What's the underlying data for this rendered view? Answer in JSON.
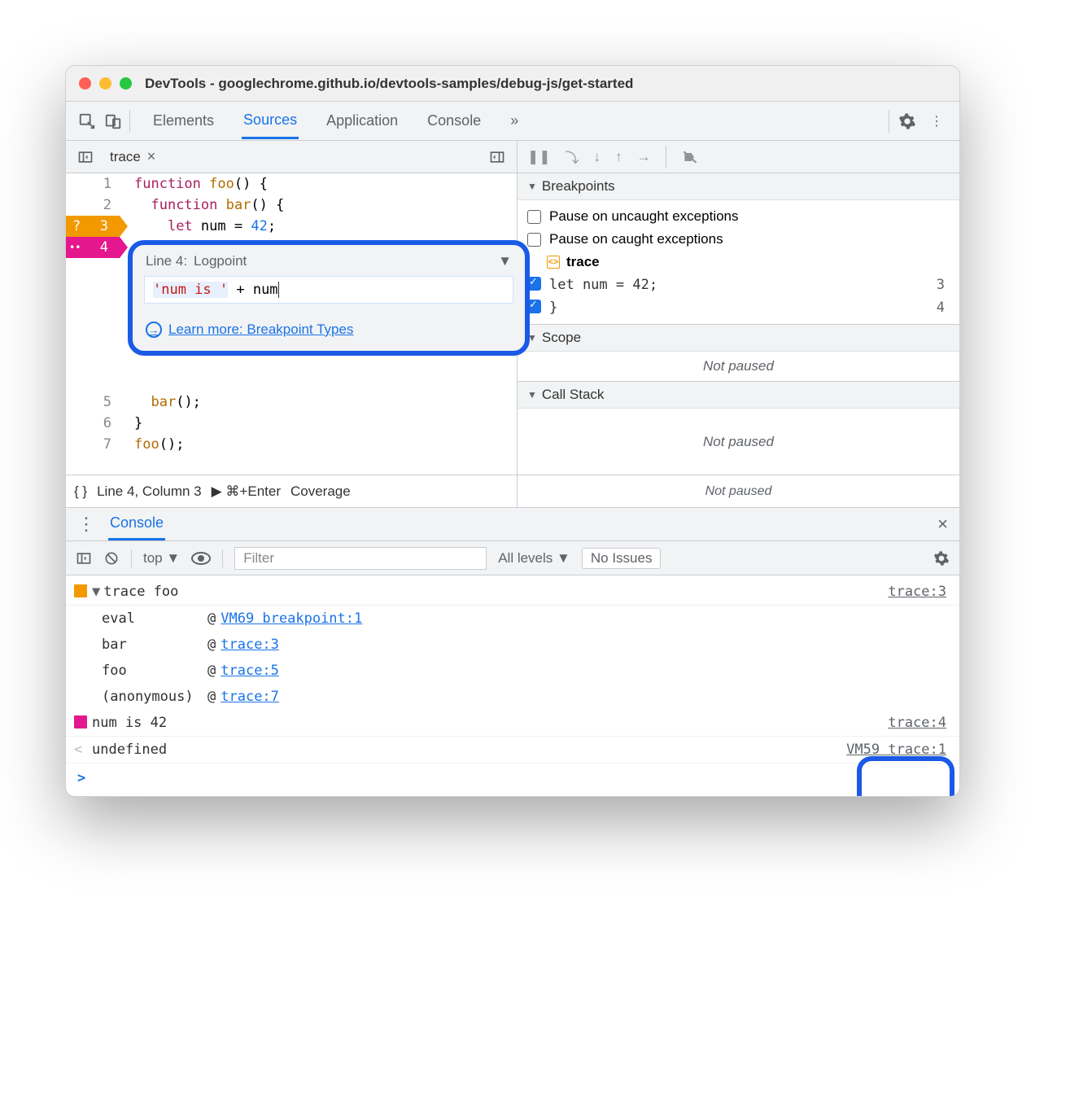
{
  "window": {
    "title": "DevTools - googlechrome.github.io/devtools-samples/debug-js/get-started"
  },
  "tabs": {
    "elements": "Elements",
    "sources": "Sources",
    "application": "Application",
    "console": "Console",
    "more": "»"
  },
  "file_tab": {
    "name": "trace"
  },
  "code": {
    "lines": [
      {
        "n": "1",
        "t": "function foo() {"
      },
      {
        "n": "2",
        "t": "  function bar() {"
      },
      {
        "n": "3",
        "t": "    let num = 42;",
        "cls": "orange"
      },
      {
        "n": "4",
        "t": "  }",
        "cls": "pink"
      },
      {
        "n": "5",
        "t": "  bar();"
      },
      {
        "n": "6",
        "t": "}"
      },
      {
        "n": "7",
        "t": "foo();"
      }
    ]
  },
  "popup": {
    "label": "Line 4:",
    "select": "Logpoint",
    "expr_str": "'num is '",
    "expr_rest": " + num",
    "learn": "Learn more: Breakpoint Types"
  },
  "side": {
    "breakpoints": "Breakpoints",
    "pause_uncaught": "Pause on uncaught exceptions",
    "pause_caught": "Pause on caught exceptions",
    "file": "trace",
    "bp1": {
      "txt": "let num = 42;",
      "no": "3"
    },
    "bp2": {
      "txt": "}",
      "no": "4"
    },
    "scope": "Scope",
    "callstack": "Call Stack",
    "not_paused": "Not paused"
  },
  "status": {
    "pretty": "{ }",
    "pos": "Line 4, Column 3",
    "run": "▶ ⌘+Enter",
    "cov": "Coverage"
  },
  "drawer": {
    "console": "Console"
  },
  "console_tb": {
    "top": "top",
    "filter": "Filter",
    "levels": "All levels",
    "issues": "No Issues"
  },
  "console": {
    "trace_head": "trace foo",
    "trace_loc": "trace:3",
    "stack": [
      {
        "fn": "eval",
        "lnk": "VM69 breakpoint:1"
      },
      {
        "fn": "bar",
        "lnk": "trace:3"
      },
      {
        "fn": "foo",
        "lnk": "trace:5"
      },
      {
        "fn": "(anonymous)",
        "lnk": "trace:7"
      }
    ],
    "log_msg": "num is 42",
    "log_loc": "trace:4",
    "undef": "undefined",
    "undef_loc": "VM59 trace:1"
  }
}
